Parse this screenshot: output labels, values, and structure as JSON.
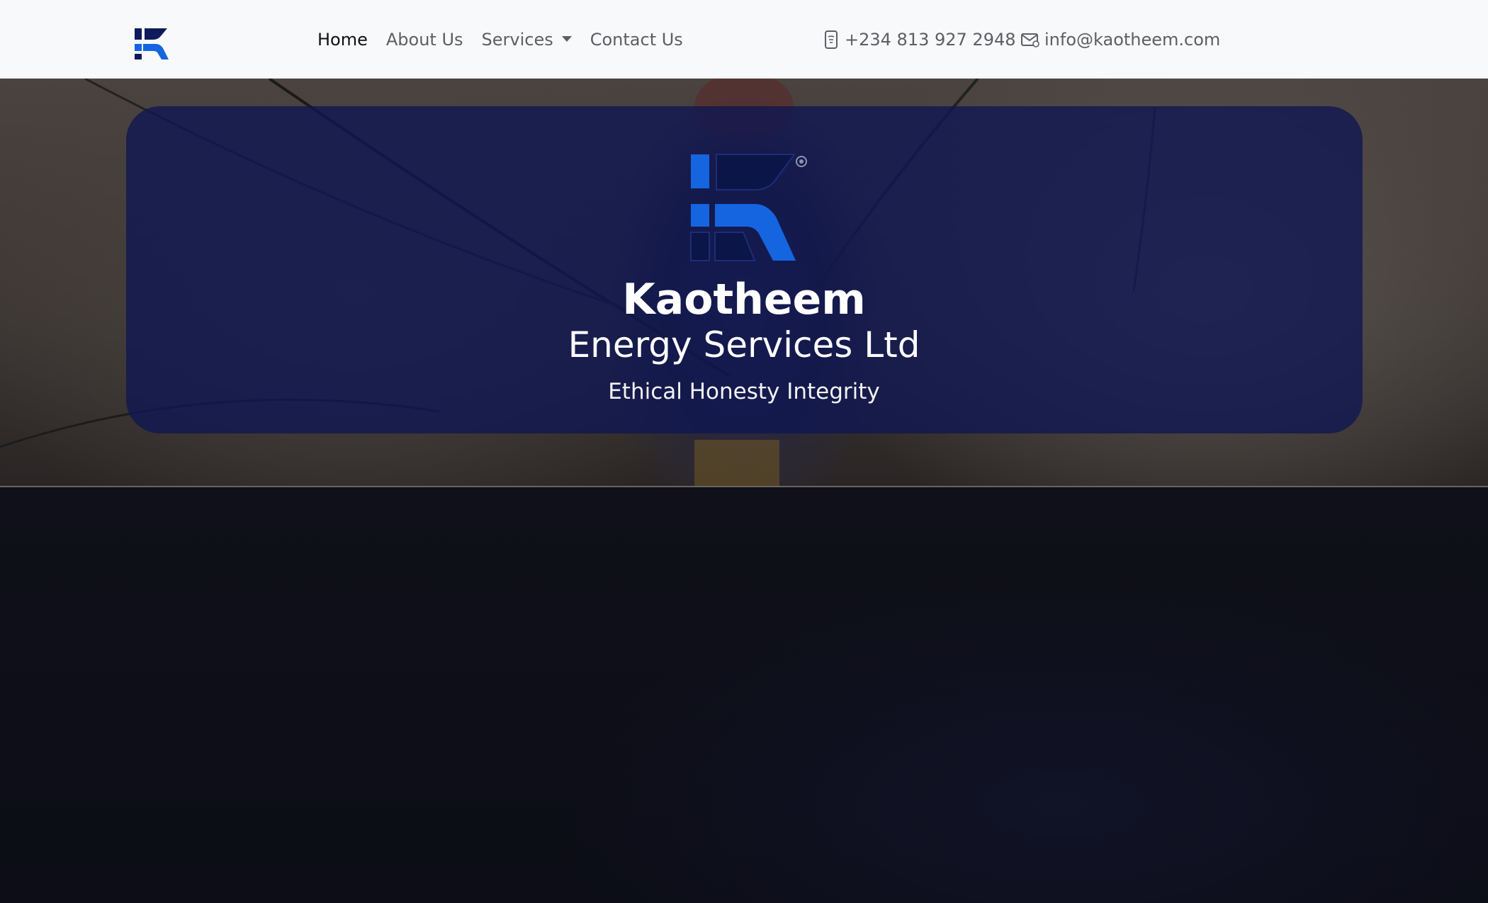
{
  "navbar": {
    "links": [
      {
        "label": "Home",
        "active": true
      },
      {
        "label": "About Us"
      },
      {
        "label": "Services",
        "dropdown": true
      },
      {
        "label": "Contact Us"
      }
    ],
    "phone": "+234 813 927 2948",
    "email": "info@kaotheem.com",
    "phone_icon": "phone-icon",
    "email_icon": "envelope-icon"
  },
  "hero": {
    "title": "Kaotheem",
    "subtitle": "Energy Services Ltd",
    "tagline": "Ethical Honesty Integrity"
  },
  "colors": {
    "brand_blue": "#1565e0",
    "brand_navy": "#0e1652",
    "card_bg": "#0e1652",
    "navbar_bg": "#f8f9fa"
  }
}
